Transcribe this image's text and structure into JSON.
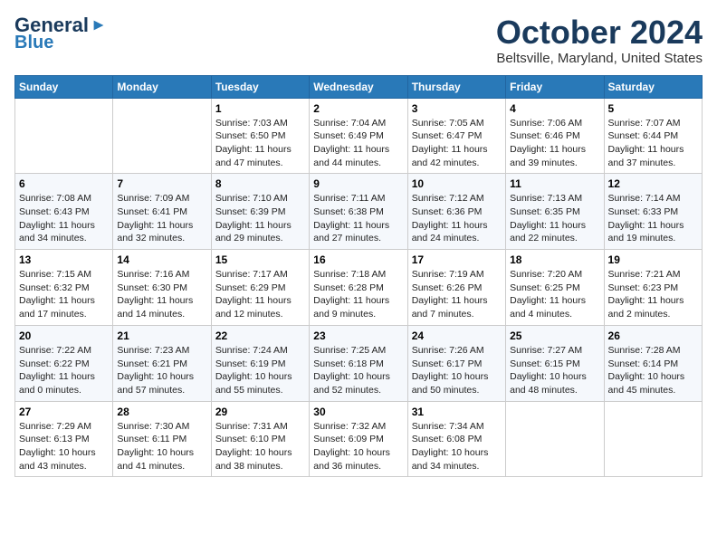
{
  "header": {
    "logo_line1": "General",
    "logo_line2": "Blue",
    "month": "October 2024",
    "location": "Beltsville, Maryland, United States"
  },
  "days_of_week": [
    "Sunday",
    "Monday",
    "Tuesday",
    "Wednesday",
    "Thursday",
    "Friday",
    "Saturday"
  ],
  "weeks": [
    [
      {
        "num": "",
        "sunrise": "",
        "sunset": "",
        "daylight": ""
      },
      {
        "num": "",
        "sunrise": "",
        "sunset": "",
        "daylight": ""
      },
      {
        "num": "1",
        "sunrise": "Sunrise: 7:03 AM",
        "sunset": "Sunset: 6:50 PM",
        "daylight": "Daylight: 11 hours and 47 minutes."
      },
      {
        "num": "2",
        "sunrise": "Sunrise: 7:04 AM",
        "sunset": "Sunset: 6:49 PM",
        "daylight": "Daylight: 11 hours and 44 minutes."
      },
      {
        "num": "3",
        "sunrise": "Sunrise: 7:05 AM",
        "sunset": "Sunset: 6:47 PM",
        "daylight": "Daylight: 11 hours and 42 minutes."
      },
      {
        "num": "4",
        "sunrise": "Sunrise: 7:06 AM",
        "sunset": "Sunset: 6:46 PM",
        "daylight": "Daylight: 11 hours and 39 minutes."
      },
      {
        "num": "5",
        "sunrise": "Sunrise: 7:07 AM",
        "sunset": "Sunset: 6:44 PM",
        "daylight": "Daylight: 11 hours and 37 minutes."
      }
    ],
    [
      {
        "num": "6",
        "sunrise": "Sunrise: 7:08 AM",
        "sunset": "Sunset: 6:43 PM",
        "daylight": "Daylight: 11 hours and 34 minutes."
      },
      {
        "num": "7",
        "sunrise": "Sunrise: 7:09 AM",
        "sunset": "Sunset: 6:41 PM",
        "daylight": "Daylight: 11 hours and 32 minutes."
      },
      {
        "num": "8",
        "sunrise": "Sunrise: 7:10 AM",
        "sunset": "Sunset: 6:39 PM",
        "daylight": "Daylight: 11 hours and 29 minutes."
      },
      {
        "num": "9",
        "sunrise": "Sunrise: 7:11 AM",
        "sunset": "Sunset: 6:38 PM",
        "daylight": "Daylight: 11 hours and 27 minutes."
      },
      {
        "num": "10",
        "sunrise": "Sunrise: 7:12 AM",
        "sunset": "Sunset: 6:36 PM",
        "daylight": "Daylight: 11 hours and 24 minutes."
      },
      {
        "num": "11",
        "sunrise": "Sunrise: 7:13 AM",
        "sunset": "Sunset: 6:35 PM",
        "daylight": "Daylight: 11 hours and 22 minutes."
      },
      {
        "num": "12",
        "sunrise": "Sunrise: 7:14 AM",
        "sunset": "Sunset: 6:33 PM",
        "daylight": "Daylight: 11 hours and 19 minutes."
      }
    ],
    [
      {
        "num": "13",
        "sunrise": "Sunrise: 7:15 AM",
        "sunset": "Sunset: 6:32 PM",
        "daylight": "Daylight: 11 hours and 17 minutes."
      },
      {
        "num": "14",
        "sunrise": "Sunrise: 7:16 AM",
        "sunset": "Sunset: 6:30 PM",
        "daylight": "Daylight: 11 hours and 14 minutes."
      },
      {
        "num": "15",
        "sunrise": "Sunrise: 7:17 AM",
        "sunset": "Sunset: 6:29 PM",
        "daylight": "Daylight: 11 hours and 12 minutes."
      },
      {
        "num": "16",
        "sunrise": "Sunrise: 7:18 AM",
        "sunset": "Sunset: 6:28 PM",
        "daylight": "Daylight: 11 hours and 9 minutes."
      },
      {
        "num": "17",
        "sunrise": "Sunrise: 7:19 AM",
        "sunset": "Sunset: 6:26 PM",
        "daylight": "Daylight: 11 hours and 7 minutes."
      },
      {
        "num": "18",
        "sunrise": "Sunrise: 7:20 AM",
        "sunset": "Sunset: 6:25 PM",
        "daylight": "Daylight: 11 hours and 4 minutes."
      },
      {
        "num": "19",
        "sunrise": "Sunrise: 7:21 AM",
        "sunset": "Sunset: 6:23 PM",
        "daylight": "Daylight: 11 hours and 2 minutes."
      }
    ],
    [
      {
        "num": "20",
        "sunrise": "Sunrise: 7:22 AM",
        "sunset": "Sunset: 6:22 PM",
        "daylight": "Daylight: 11 hours and 0 minutes."
      },
      {
        "num": "21",
        "sunrise": "Sunrise: 7:23 AM",
        "sunset": "Sunset: 6:21 PM",
        "daylight": "Daylight: 10 hours and 57 minutes."
      },
      {
        "num": "22",
        "sunrise": "Sunrise: 7:24 AM",
        "sunset": "Sunset: 6:19 PM",
        "daylight": "Daylight: 10 hours and 55 minutes."
      },
      {
        "num": "23",
        "sunrise": "Sunrise: 7:25 AM",
        "sunset": "Sunset: 6:18 PM",
        "daylight": "Daylight: 10 hours and 52 minutes."
      },
      {
        "num": "24",
        "sunrise": "Sunrise: 7:26 AM",
        "sunset": "Sunset: 6:17 PM",
        "daylight": "Daylight: 10 hours and 50 minutes."
      },
      {
        "num": "25",
        "sunrise": "Sunrise: 7:27 AM",
        "sunset": "Sunset: 6:15 PM",
        "daylight": "Daylight: 10 hours and 48 minutes."
      },
      {
        "num": "26",
        "sunrise": "Sunrise: 7:28 AM",
        "sunset": "Sunset: 6:14 PM",
        "daylight": "Daylight: 10 hours and 45 minutes."
      }
    ],
    [
      {
        "num": "27",
        "sunrise": "Sunrise: 7:29 AM",
        "sunset": "Sunset: 6:13 PM",
        "daylight": "Daylight: 10 hours and 43 minutes."
      },
      {
        "num": "28",
        "sunrise": "Sunrise: 7:30 AM",
        "sunset": "Sunset: 6:11 PM",
        "daylight": "Daylight: 10 hours and 41 minutes."
      },
      {
        "num": "29",
        "sunrise": "Sunrise: 7:31 AM",
        "sunset": "Sunset: 6:10 PM",
        "daylight": "Daylight: 10 hours and 38 minutes."
      },
      {
        "num": "30",
        "sunrise": "Sunrise: 7:32 AM",
        "sunset": "Sunset: 6:09 PM",
        "daylight": "Daylight: 10 hours and 36 minutes."
      },
      {
        "num": "31",
        "sunrise": "Sunrise: 7:34 AM",
        "sunset": "Sunset: 6:08 PM",
        "daylight": "Daylight: 10 hours and 34 minutes."
      },
      {
        "num": "",
        "sunrise": "",
        "sunset": "",
        "daylight": ""
      },
      {
        "num": "",
        "sunrise": "",
        "sunset": "",
        "daylight": ""
      }
    ]
  ]
}
